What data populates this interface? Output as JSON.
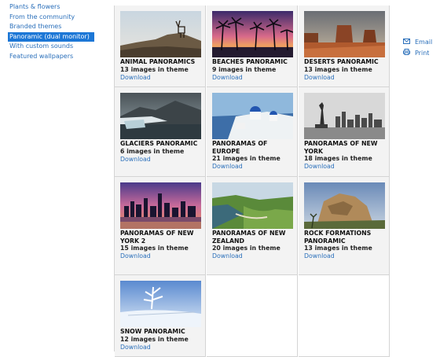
{
  "sidebar": {
    "items": [
      {
        "label": "Plants & flowers",
        "active": false
      },
      {
        "label": "From the community",
        "active": false
      },
      {
        "label": "Branded themes",
        "active": false
      },
      {
        "label": "Panoramic (dual monitor)",
        "active": true
      },
      {
        "label": "With custom sounds",
        "active": false
      },
      {
        "label": "Featured wallpapers",
        "active": false
      }
    ]
  },
  "actions": {
    "email": {
      "label": "Email",
      "icon": "email-icon"
    },
    "print": {
      "label": "Print",
      "icon": "printer-icon"
    }
  },
  "themes": [
    {
      "title": "ANIMAL PANORAMICS",
      "count": "13 images in theme",
      "download": "Download"
    },
    {
      "title": "BEACHES PANORAMIC",
      "count": "9 images in theme",
      "download": "Download"
    },
    {
      "title": "DESERTS PANORAMIC",
      "count": "13 images in theme",
      "download": "Download"
    },
    {
      "title": "GLACIERS PANORAMIC",
      "count": "6 images in theme",
      "download": "Download"
    },
    {
      "title": "PANORAMAS OF EUROPE",
      "count": "21 images in theme",
      "download": "Download"
    },
    {
      "title": "PANORAMAS OF NEW YORK",
      "count": "18 images in theme",
      "download": "Download"
    },
    {
      "title": "PANORAMAS OF NEW YORK 2",
      "count": "15 images in theme",
      "download": "Download"
    },
    {
      "title": "PANORAMAS OF NEW ZEALAND",
      "count": "20 images in theme",
      "download": "Download"
    },
    {
      "title": "ROCK FORMATIONS PANORAMIC",
      "count": "13 images in theme",
      "download": "Download"
    },
    {
      "title": "SNOW PANORAMIC",
      "count": "12 images in theme",
      "download": "Download"
    }
  ],
  "colors": {
    "link": "#2a6fba",
    "active_bg": "#1c77d6",
    "cell_bg": "#f3f3f3"
  }
}
